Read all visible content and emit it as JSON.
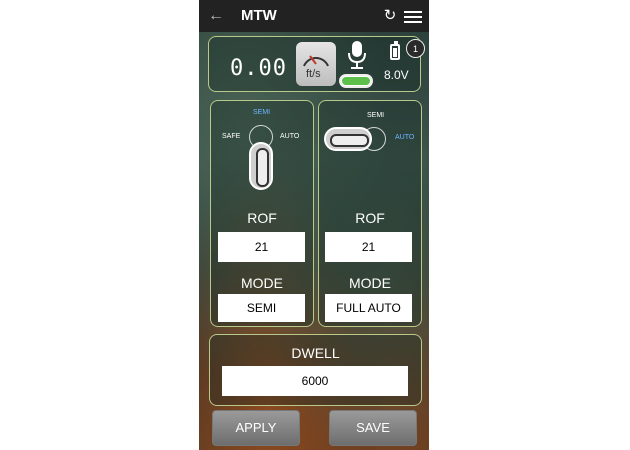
{
  "header": {
    "title": "MTW"
  },
  "status": {
    "speed": "0.00",
    "speed_unit": "ft/s",
    "voltage": "8.0V",
    "badge": "1",
    "battery_level_fraction": 0.6
  },
  "left_selector": {
    "safe": "SAFE",
    "semi": "SEMI",
    "auto": "AUTO",
    "selected": "SEMI"
  },
  "right_selector": {
    "semi": "SEMI",
    "auto": "AUTO",
    "selected": "AUTO"
  },
  "left": {
    "rof_label": "ROF",
    "rof_value": "21",
    "mode_label": "MODE",
    "mode_value": "SEMI"
  },
  "right": {
    "rof_label": "ROF",
    "rof_value": "21",
    "mode_label": "MODE",
    "mode_value": "FULL AUTO"
  },
  "dwell": {
    "label": "DWELL",
    "value": "6000"
  },
  "buttons": {
    "apply": "APPLY",
    "save": "SAVE"
  },
  "colors": {
    "accent_active": "#6fb6ff",
    "panel_border": "#b8c98a",
    "toggle_on": "#5dc04a"
  }
}
